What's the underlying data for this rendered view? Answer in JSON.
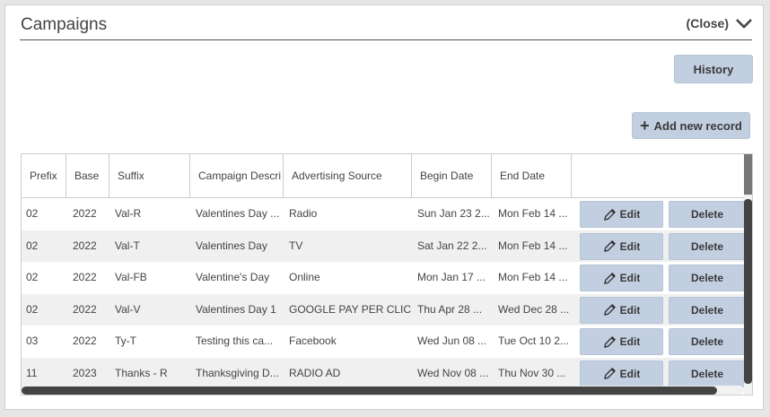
{
  "panel": {
    "title": "Campaigns",
    "close_label": "(Close)"
  },
  "buttons": {
    "history": "History",
    "add_new_record": "Add new record"
  },
  "table": {
    "columns": [
      "Prefix",
      "Base",
      "Suffix",
      "Campaign Descri",
      "Advertising Source",
      "Begin Date",
      "End Date"
    ],
    "rows": [
      {
        "prefix": "02",
        "base": "2022",
        "suffix": "Val-R",
        "description": "Valentines Day ...",
        "source": "Radio",
        "begin": "Sun Jan 23 2...",
        "end": "Mon Feb 14 ..."
      },
      {
        "prefix": "02",
        "base": "2022",
        "suffix": "Val-T",
        "description": "Valentines Day",
        "source": "TV",
        "begin": "Sat Jan 22 2...",
        "end": "Mon Feb 14 ..."
      },
      {
        "prefix": "02",
        "base": "2022",
        "suffix": "Val-FB",
        "description": "Valentine's Day",
        "source": "Online",
        "begin": "Mon Jan 17 ...",
        "end": "Mon Feb 14 ..."
      },
      {
        "prefix": "02",
        "base": "2022",
        "suffix": "Val-V",
        "description": "Valentines Day 1",
        "source": "GOOGLE PAY PER CLICK",
        "begin": "Thu Apr 28 ...",
        "end": "Wed Dec 28 ..."
      },
      {
        "prefix": "03",
        "base": "2022",
        "suffix": "Ty-T",
        "description": "Testing this ca...",
        "source": "Facebook",
        "begin": "Wed Jun 08 ...",
        "end": "Tue Oct 10 2..."
      },
      {
        "prefix": "11",
        "base": "2023",
        "suffix": "Thanks - R",
        "description": "Thanksgiving D...",
        "source": "RADIO AD",
        "begin": "Wed Nov 08 ...",
        "end": "Thu Nov 30 ..."
      }
    ],
    "edit_label": "Edit",
    "delete_label": "Delete"
  },
  "icons": {
    "close": "chevron-down-icon",
    "add": "plus-icon",
    "edit": "pencil-icon"
  },
  "colors": {
    "button_bg": "#c2cfe0",
    "alt_row": "#f0f0f0"
  }
}
